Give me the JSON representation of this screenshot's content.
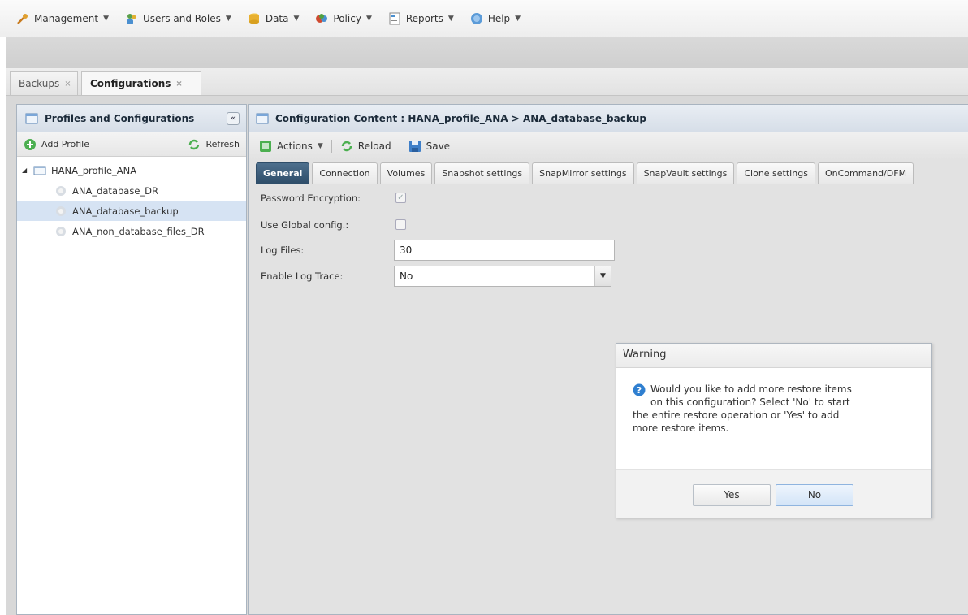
{
  "menu": {
    "items": [
      {
        "label": "Management",
        "icon": "wrench-icon"
      },
      {
        "label": "Users and Roles",
        "icon": "users-icon"
      },
      {
        "label": "Data",
        "icon": "database-icon"
      },
      {
        "label": "Policy",
        "icon": "policy-icon"
      },
      {
        "label": "Reports",
        "icon": "report-icon"
      },
      {
        "label": "Help",
        "icon": "help-icon"
      }
    ]
  },
  "tabs": {
    "backups": "Backups",
    "configurations": "Configurations",
    "close_glyph": "×"
  },
  "left_panel": {
    "title": "Profiles and Configurations",
    "collapse_glyph": "«",
    "add_profile": "Add Profile",
    "refresh": "Refresh",
    "tree": {
      "root": "HANA_profile_ANA",
      "children": [
        "ANA_database_DR",
        "ANA_database_backup",
        "ANA_non_database_files_DR"
      ],
      "selected_index": 1
    }
  },
  "right_panel": {
    "title": "Configuration Content : HANA_profile_ANA > ANA_database_backup",
    "toolbar": {
      "actions": "Actions",
      "reload": "Reload",
      "save": "Save"
    },
    "subtabs": [
      "General",
      "Connection",
      "Volumes",
      "Snapshot settings",
      "SnapMirror settings",
      "SnapVault settings",
      "Clone settings",
      "OnCommand/DFM"
    ],
    "active_subtab": "General",
    "form": {
      "password_encryption_label": "Password Encryption:",
      "password_encryption_checked": true,
      "use_global_config_label": "Use Global config.:",
      "use_global_config_checked": false,
      "log_files_label": "Log Files:",
      "log_files_value": "30",
      "enable_log_trace_label": "Enable Log Trace:",
      "enable_log_trace_value": "No"
    }
  },
  "dialog": {
    "title": "Warning",
    "message_line1": "Would you like to add more restore items",
    "message_line2": "on this configuration? Select 'No' to start",
    "message_line3": "the entire restore operation or 'Yes' to add",
    "message_line4": "more restore items.",
    "yes_label": "Yes",
    "no_label": "No"
  },
  "colors": {
    "active_tab": "#2e4d69",
    "selected_row": "#d6e3f3",
    "info_icon": "#2f7fd0"
  }
}
